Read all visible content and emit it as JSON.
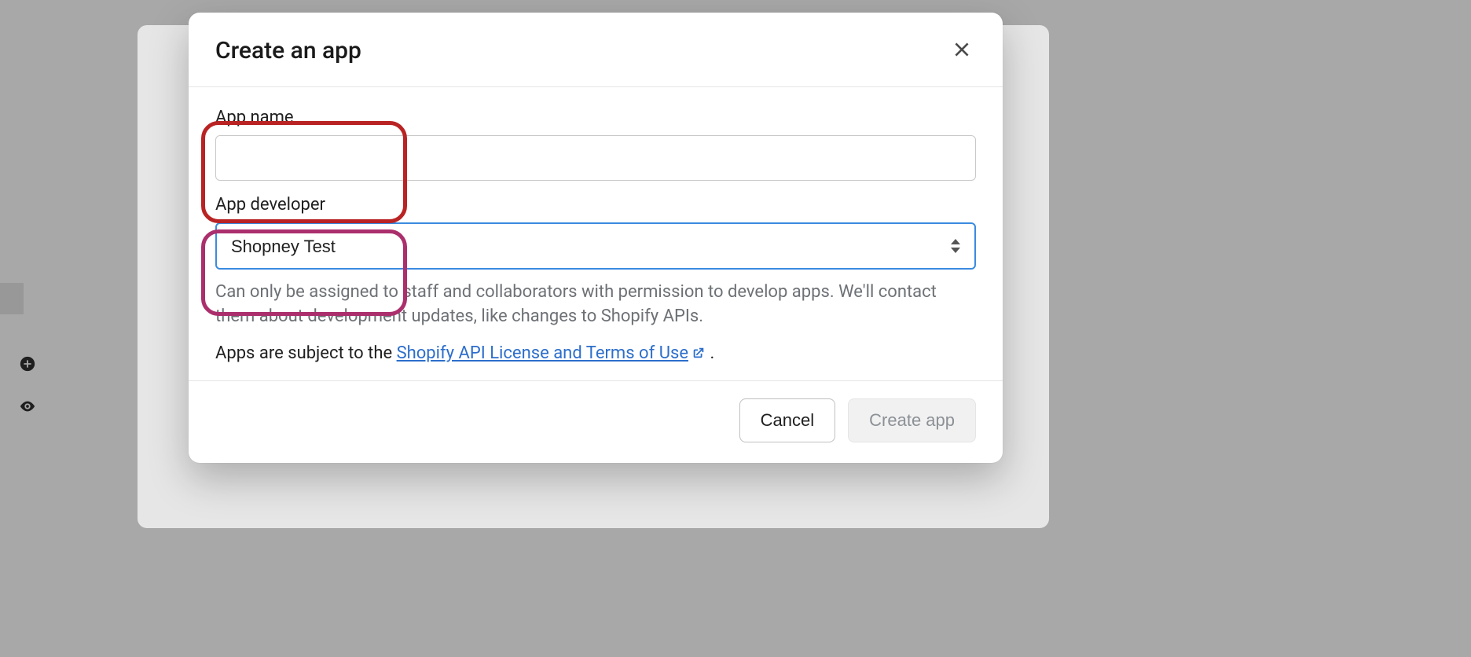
{
  "modal": {
    "title": "Create an app",
    "fields": {
      "app_name": {
        "label": "App name",
        "value": ""
      },
      "app_developer": {
        "label": "App developer",
        "value": "Shopney Test"
      }
    },
    "helper_text": "Can only be assigned to staff and collaborators with permission to develop apps. We'll contact them about development updates, like changes to Shopify APIs.",
    "terms_prefix": "Apps are subject to the ",
    "terms_link_text": "Shopify API License and Terms of Use",
    "terms_suffix": " .",
    "buttons": {
      "cancel": "Cancel",
      "create": "Create app"
    }
  }
}
